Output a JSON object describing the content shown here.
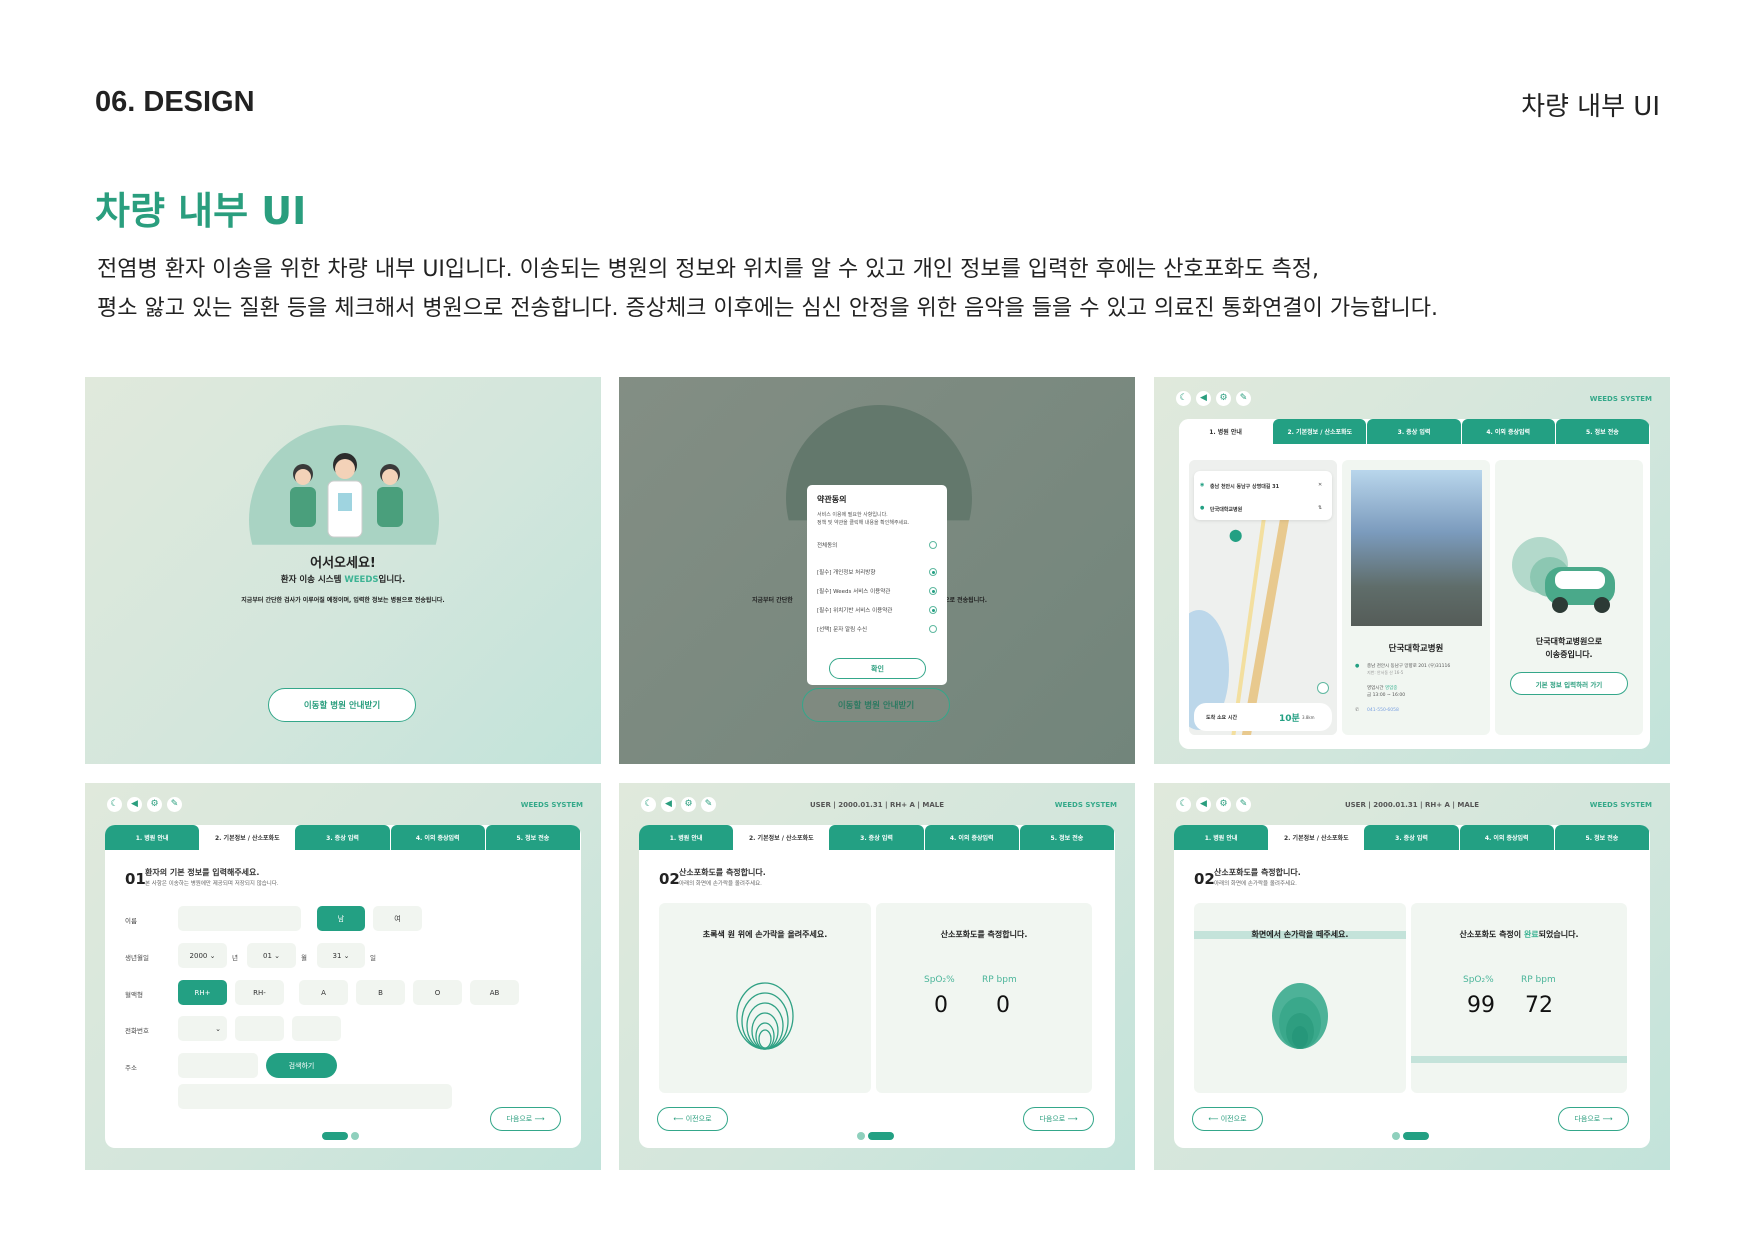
{
  "header": {
    "section": "06. DESIGN",
    "right_title": "차량 내부 UI"
  },
  "title": "차량 내부 UI",
  "description": [
    "전염병 환자 이송을 위한 차량 내부 UI입니다. 이송되는 병원의 정보와 위치를 알 수 있고 개인 정보를 입력한 후에는 산호포화도 측정,",
    "평소 앓고 있는 질환 등을 체크해서 병원으로 전송합니다. 증상체크 이후에는 심신 안정을 위한 음악을 들을 수 있고 의료진 통화연결이 가능합니다."
  ],
  "common": {
    "brand": "WEEDS SYSTEM",
    "user_info": "USER  |  2000.01.31  |  RH+ A  |  MALE",
    "tabs": [
      "1. 병원 안내",
      "2. 기본정보 / 산소포화도",
      "3. 증상 입력",
      "4. 이외 증상입력",
      "5. 정보 전송"
    ],
    "prev": "⟵ 이전으로",
    "next": "다음으로 ⟶",
    "accent": "#23a083"
  },
  "welcome": {
    "greeting": "어서오세요!",
    "subtitle_pre": "환자 이송 시스템 ",
    "subtitle_brand": "WEEDS",
    "subtitle_post": "입니다.",
    "info": "지금부터 간단한 검사가 이루어질 예정이며, 입력한 정보는 병원으로 전송됩니다.",
    "button": "이동할 병원 안내받기"
  },
  "terms": {
    "title": "약관동의",
    "desc1": "서비스 이용에 필요한 사항입니다.",
    "desc2": "정책 및 약관을 클릭해 내용을 확인해주세요.",
    "all": "전체동의",
    "items": [
      {
        "label": "[필수] 개인정보 처리방향",
        "checked": true
      },
      {
        "label": "[필수] Weeds 서비스 이용약관",
        "checked": true
      },
      {
        "label": "[필수] 위치기반 서비스 이용약관",
        "checked": true
      },
      {
        "label": "[선택] 문자 알림 수신",
        "checked": false
      }
    ],
    "confirm": "확인",
    "bg_left": "지금부터 간단한",
    "bg_right": "으로 전송됩니다."
  },
  "hospital": {
    "from": "충남 천안시 동남구 상명대길 31",
    "to": "단국대학교병원",
    "eta_label": "도착 소요 시간",
    "eta": "10분",
    "distance": "3.8km",
    "name": "단국대학교병원",
    "address": "충남 천안시 동남구 망향로 201 (우)31116",
    "address_sub": "지번: 안서동 산 16-5",
    "hours_label": "영업시간",
    "hours_status": "영업중",
    "hours": "금 13:00 ~ 16:00",
    "phone": "041-550-6058",
    "transfer_line1": "단국대학교병원으로",
    "transfer_line2": "이송중입니다.",
    "go_button": "기본 정보 입력하러 가기"
  },
  "form": {
    "num": "01",
    "heading": "환자의 기본 정보를 입력해주세요.",
    "note": "본 사항은 이송하는 병원에만 제공되며 저장되지 않습니다.",
    "labels": {
      "name": "이름",
      "birth": "생년월일",
      "blood": "혈액형",
      "phone": "전화번호",
      "address": "주소"
    },
    "male": "남",
    "female": "여",
    "year": "2000",
    "year_unit": "년",
    "month": "01",
    "month_unit": "월",
    "day": "31",
    "day_unit": "일",
    "blood_types": [
      "RH+",
      "RH-",
      "A",
      "B",
      "O",
      "AB"
    ],
    "search": "검색하기"
  },
  "measure": {
    "num": "02",
    "heading": "산소포화도를 측정합니다.",
    "note": "아래의 화면에 손가락을 올려주세요.",
    "left_prompt": "초록색 원 위에 손가락을 올려주세요.",
    "right_title": "산소포화도를 측정합니다.",
    "spo2_label": "SpO₂%",
    "rp_label": "RP bpm",
    "spo2": "0",
    "rp": "0"
  },
  "measure_done": {
    "num": "02",
    "heading": "산소포화도를 측정합니다.",
    "note": "아래의 화면에 손가락을 올려주세요.",
    "left_prompt": "화면에서 손가락을 떼주세요.",
    "right_pre": "산소포화도 측정이 ",
    "right_hl": "완료",
    "right_post": "되었습니다.",
    "spo2_label": "SpO₂%",
    "rp_label": "RP bpm",
    "spo2": "99",
    "rp": "72"
  }
}
